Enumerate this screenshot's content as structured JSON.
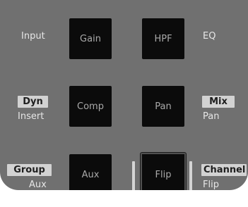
{
  "buttons": {
    "gain": "Gain",
    "hpf": "HPF",
    "comp": "Comp",
    "pan": "Pan",
    "aux": "Aux",
    "flip": "Flip"
  },
  "labels": {
    "input": "Input",
    "eq": "EQ",
    "dyn_tag": "Dyn",
    "insert": "Insert",
    "mix_tag": "Mix",
    "pan": "Pan",
    "group_tag": "Group",
    "aux": "Aux",
    "channel_tag": "Channel",
    "flip": "Flip"
  },
  "colors": {
    "panel": "#707070",
    "button": "#0b0b0b",
    "button_text": "#a9a9a9",
    "label_text": "#e6e6e6",
    "tag_background": "#d2d2d2",
    "tag_text": "#1e1e1e"
  }
}
